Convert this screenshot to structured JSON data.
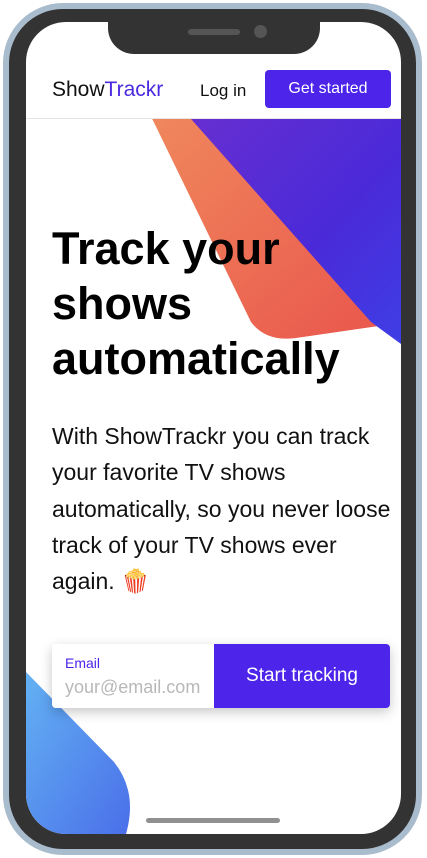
{
  "navbar": {
    "logo_primary": "Show",
    "logo_accent": "Trackr",
    "login_label": "Log in",
    "cta_label": "Get started"
  },
  "hero": {
    "headline": "Track your shows automatically",
    "subtext": "With ShowTrackr you can track your favorite TV shows automatically, so you never loose track of your TV shows ever again. 🍿"
  },
  "signup": {
    "email_label": "Email",
    "email_placeholder": "your@email.com",
    "email_value": "",
    "button_label": "Start tracking"
  },
  "colors": {
    "accent": "#4c24ea",
    "gradient_orange": "#f0845a",
    "gradient_red": "#ea5a4e",
    "gradient_purple": "#5b2bd8",
    "gradient_blue": "#4a5ee8",
    "light_blue": "#5aa0ee"
  }
}
